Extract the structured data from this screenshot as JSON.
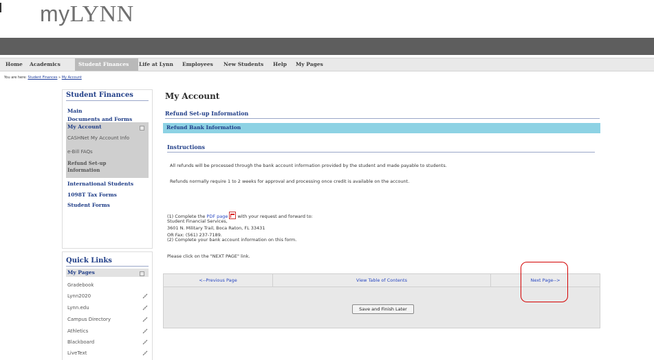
{
  "logo": {
    "pre": "my",
    "caps": "LYNN"
  },
  "nav": {
    "items": [
      {
        "label": "Home",
        "active": false
      },
      {
        "label": "Academics",
        "active": false
      },
      {
        "label": "Student Finances",
        "active": true
      },
      {
        "label": "Life at Lynn",
        "active": false
      },
      {
        "label": "Employees",
        "active": false
      },
      {
        "label": "New Students",
        "active": false
      },
      {
        "label": "Help",
        "active": false
      },
      {
        "label": "My Pages",
        "active": false
      }
    ]
  },
  "breadcrumb": {
    "prefix": "You are here:",
    "part1": "Student Finances",
    "sep": "»",
    "part2": "My Account"
  },
  "sidebar": {
    "title": "Student Finances",
    "main": "Main",
    "documents": "Documents and Forms",
    "my_account": "My Account",
    "cashnet": "CASHNet My Account Info",
    "ebill": "e-Bill FAQs",
    "refund_line1": "Refund Set-up",
    "refund_line2": "Information",
    "international": "International Students",
    "tax": "1098T Tax Forms",
    "student_forms": "Student Forms"
  },
  "quick_links": {
    "title": "Quick Links",
    "my_pages": "My Pages",
    "items": [
      "Gradebook",
      "Lynn2020",
      "Lynn.edu",
      "Campus Directory",
      "Athletics",
      "Blackboard",
      "LiveText"
    ]
  },
  "main": {
    "title": "My Account",
    "section": "Refund Set-up Information",
    "bar": "Refund Bank Information",
    "instructions": "Instructions",
    "p1": "All refunds will be processed through the bank account information provided by the student and made payable to students.",
    "p2": "Refunds normally require 1 to 2 weeks for approval and processing once credit is available on the account.",
    "step1_pre": "(1) Complete the ",
    "pdf_link": "PDF page",
    "step1_post": " with your request and forward to:",
    "addr1": "Student Financial Services,",
    "addr2": "3601 N. Military Trail, Boca Raton, FL 33431",
    "addr3": "OR Fax: (561) 237-7189.",
    "step2": "(2) Complete your bank account information on this form.",
    "click": "Please click on the \"NEXT PAGE\" link.",
    "prev": "<--Previous Page",
    "toc": "View Table of Contents",
    "next": "Next Page-->",
    "save": "Save and Finish Later"
  },
  "colors": {
    "accent_blue": "#1f3d87",
    "info_bar": "#8dd2e4",
    "highlight": "#d40000",
    "banner": "#5e5e5e"
  }
}
